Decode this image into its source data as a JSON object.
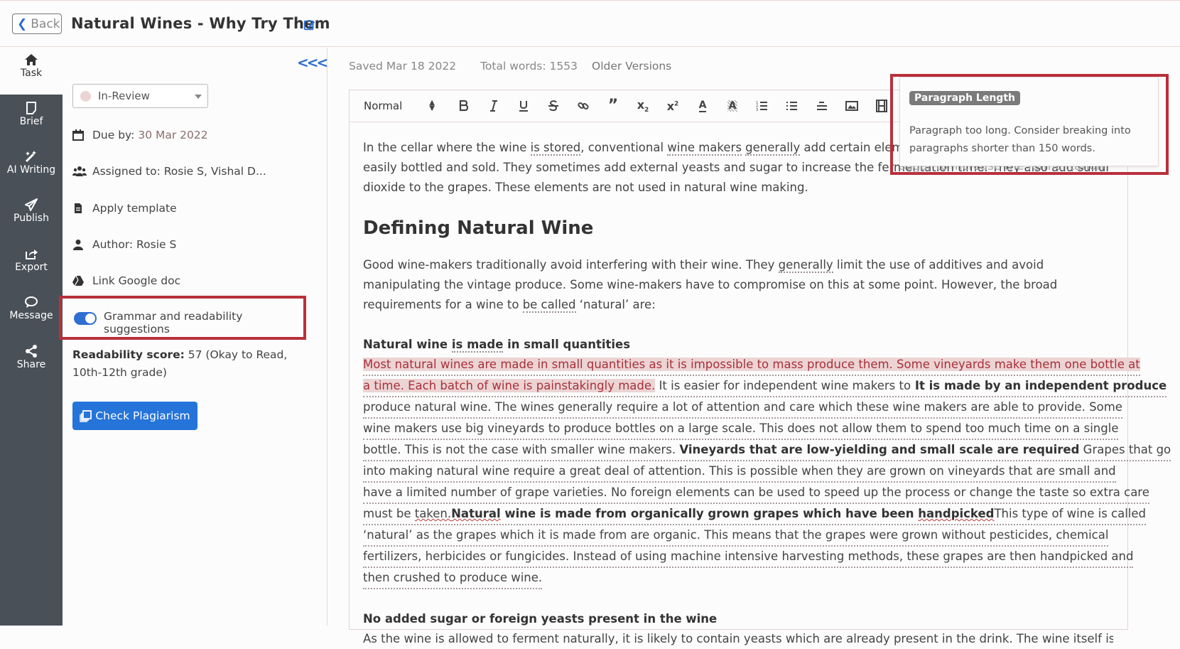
{
  "header": {
    "back_label": "Back",
    "title": "Natural Wines - Why Try Them"
  },
  "sidenav": {
    "items": [
      {
        "label": "Task",
        "icon": "home-icon"
      },
      {
        "label": "Brief",
        "icon": "brief-icon"
      },
      {
        "label": "AI Writing",
        "icon": "magic-wand-icon"
      },
      {
        "label": "Publish",
        "icon": "paper-plane-icon"
      },
      {
        "label": "Export",
        "icon": "export-icon"
      },
      {
        "label": "Message",
        "icon": "message-icon"
      },
      {
        "label": "Share",
        "icon": "share-icon"
      }
    ]
  },
  "panel": {
    "collapse_label": "<<<",
    "status": "In-Review",
    "due_label": "Due by:",
    "due_date": "30 Mar 2022",
    "assigned": "Assigned to: Rosie S, Vishal D...",
    "apply_template": "Apply template",
    "author": "Author: Rosie S",
    "link_google_doc": "Link Google doc",
    "grammar_toggle_label": "Grammar and readability suggestions",
    "grammar_toggle_on": true,
    "readability_label": "Readability score:",
    "readability_value": "57 (Okay to Read, 10th-12th grade)",
    "plagiarism_button": "Check Plagiarism"
  },
  "meta": {
    "saved": "Saved Mar 18 2022",
    "total_words": "Total words: 1553",
    "older_versions": "Older Versions"
  },
  "toolbar": {
    "format_select": "Normal",
    "buttons": [
      "bold",
      "italic",
      "underline",
      "strike",
      "link",
      "blockquote",
      "subscript",
      "superscript",
      "text-color",
      "highlight",
      "ordered-list",
      "bullet-list",
      "align",
      "image",
      "video"
    ]
  },
  "editor": {
    "p1_a": "In the cellar where the wine ",
    "p1_u1": "is stored",
    "p1_b": ", conventional ",
    "p1_u2": "wine makers",
    "p1_c": " ",
    "p1_u3": "generally",
    "p1_d": " add certain elements to ensure that the wine can be easily bottled and sold. They sometimes add external yeasts and sugar to increase the fermentation time. They also add sulfur dioxide to the grapes. These elements are not used in natural wine making.",
    "h2": "Defining Natural Wine",
    "p2_a": "Good wine-makers traditionally avoid interfering with their wine. They ",
    "p2_u1": "generally",
    "p2_b": " limit the use of additives and avoid manipulating the vintage produce. Some wine-makers have to compromise on this at some point. However, the broad requirements for a wine to ",
    "p2_u2": "be called",
    "p2_c": " ‘natural’ are:",
    "sub1_a": "Natural wine ",
    "sub1_u": "is made",
    "sub1_b": " in small quantities",
    "lp_lines": [
      {
        "hl": "Most natural wines are made in small quantities as it is impossible to mass produce them. Some vineyards make them one bottle at"
      },
      {
        "hl": "a time. Each batch of wine is painstakingly made.",
        "bold": " It is made by an independent produce",
        "text": " It is easier for independent wine makers to"
      },
      {
        "text": "produce natural wine. The wines generally require a lot of attention and care which these wine makers are able to provide. Some"
      },
      {
        "text": "wine makers use big vineyards to produce bottles on a large scale. This does not allow them to spend too much time on a single"
      },
      {
        "text": "bottle. This is not the case with smaller wine makers. ",
        "bold": "Vineyards that are low-yielding and small scale are required",
        "text2": " Grapes that go"
      },
      {
        "text": "into making natural wine require a great deal of attention. This is possible when they are grown on vineyards that are small and"
      },
      {
        "text": "have a limited number of grape varieties. No foreign elements can be used to speed up the process or change the taste so extra care"
      },
      {
        "text": "must be ",
        "red1": "taken.",
        "bold_red": "Natural",
        "bold": " wine is made from organically grown grapes which have been ",
        "red2": "handpicked",
        "text2": "This type of wine is called"
      },
      {
        "text": "‘natural’ as the grapes which it is made from are organic. This means that the grapes were grown without pesticides, chemical"
      },
      {
        "text": "fertilizers, herbicides or fungicides. Instead of using machine intensive harvesting methods, these grapes are then handpicked and"
      },
      {
        "text": "then crushed to produce wine."
      }
    ],
    "sub2": "No added sugar or foreign yeasts present in the wine",
    "p4_partial": "As the wine is allowed to ferment naturally, it is likely to contain yeasts which are already present in the drink. The wine itself is"
  },
  "tooltip": {
    "badge": "Paragraph Length",
    "text": "Paragraph too long. Consider breaking into paragraphs shorter than 150 words.",
    "overflow_text": "sugar to increase the fermentation"
  },
  "colors": {
    "accent": "#2f6fd1",
    "sidebar_bg": "#4a5058",
    "highlight_box": "#b8303a",
    "paragraph_highlight": "#ecd4d4"
  }
}
